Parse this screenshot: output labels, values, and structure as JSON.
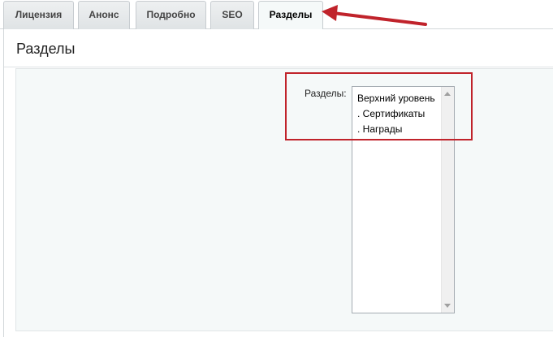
{
  "tabs": [
    {
      "label": "Лицензия",
      "active": false
    },
    {
      "label": "Анонс",
      "active": false
    },
    {
      "label": "Подробно",
      "active": false
    },
    {
      "label": "SEO",
      "active": false
    },
    {
      "label": "Разделы",
      "active": true
    }
  ],
  "section": {
    "title": "Разделы"
  },
  "form": {
    "sections_label": "Разделы:",
    "sections_options": [
      "Верхний уровень",
      ". Сертификаты",
      ". Награды"
    ]
  },
  "colors": {
    "annotation": "#c0232b"
  }
}
